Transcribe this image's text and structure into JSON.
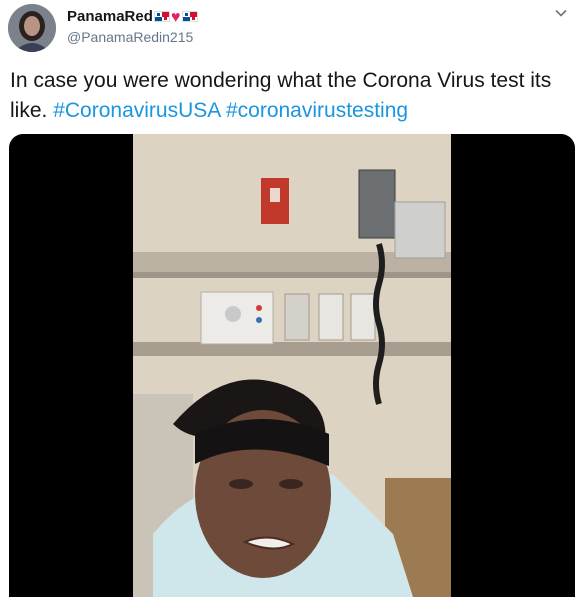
{
  "user": {
    "display_name": "PanamaRed",
    "handle": "@PanamaRedin215",
    "name_emoji": [
      "panama-flag-icon",
      "red-heart-icon",
      "panama-flag-icon"
    ]
  },
  "tweet": {
    "text": "In case you were wondering what the Corona Virus test its like.",
    "hashtags": [
      "#CoronavirusUSA",
      "#coronavirustesting"
    ]
  },
  "colors": {
    "link": "#1b95e0",
    "handle": "#657786",
    "heart": "#e0245e"
  },
  "media": {
    "type": "video",
    "content_icon": "video-thumbnail"
  }
}
